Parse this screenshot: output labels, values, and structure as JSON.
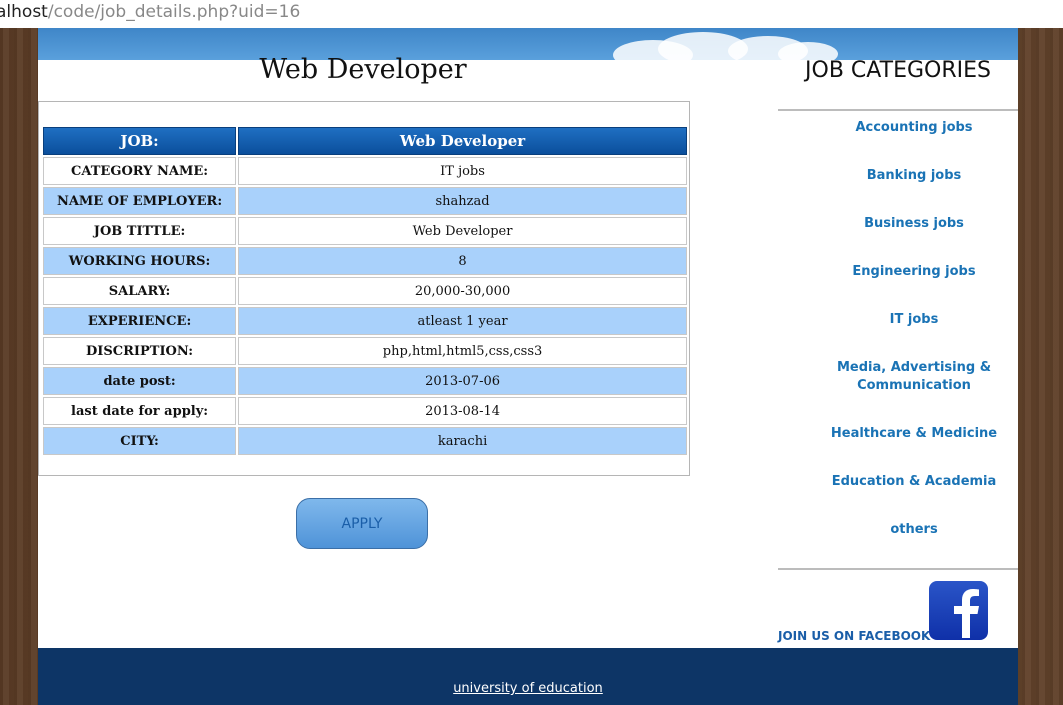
{
  "browser": {
    "url_host": "alhost",
    "url_path": "/code/job_details.php?uid=16"
  },
  "job": {
    "heading": "Web Developer",
    "table_header": {
      "key": "JOB:",
      "value": "Web Developer"
    },
    "rows": [
      {
        "key": "CATEGORY NAME:",
        "value": "IT jobs"
      },
      {
        "key": "NAME OF EMPLOYER:",
        "value": "shahzad"
      },
      {
        "key": "JOB TITTLE:",
        "value": "Web Developer"
      },
      {
        "key": "WORKING HOURS:",
        "value": "8"
      },
      {
        "key": "SALARY:",
        "value": "20,000-30,000"
      },
      {
        "key": "EXPERIENCE:",
        "value": "atleast 1 year"
      },
      {
        "key": "DISCRIPTION:",
        "value": "php,html,html5,css,css3"
      },
      {
        "key": "date post:",
        "value": "2013-07-06"
      },
      {
        "key": "last date for apply:",
        "value": "2013-08-14"
      },
      {
        "key": "CITY:",
        "value": "karachi"
      }
    ],
    "apply_label": "APPLY"
  },
  "sidebar": {
    "heading": "JOB CATEGORIES",
    "categories": [
      "Accounting jobs",
      "Banking jobs",
      "Business jobs",
      "Engineering jobs",
      "IT jobs",
      "Media, Advertising & Communication",
      "Healthcare & Medicine",
      "Education & Academia",
      "others"
    ],
    "facebook_label": "JOIN US ON FACEBOOK",
    "facebook_icon": "facebook-icon"
  },
  "footer": {
    "link": "university of education"
  },
  "colors": {
    "header_blue": "#0b4f9c",
    "row_alt": "#a9d1fb",
    "link": "#1a73b5",
    "footer": "#0d3566"
  }
}
